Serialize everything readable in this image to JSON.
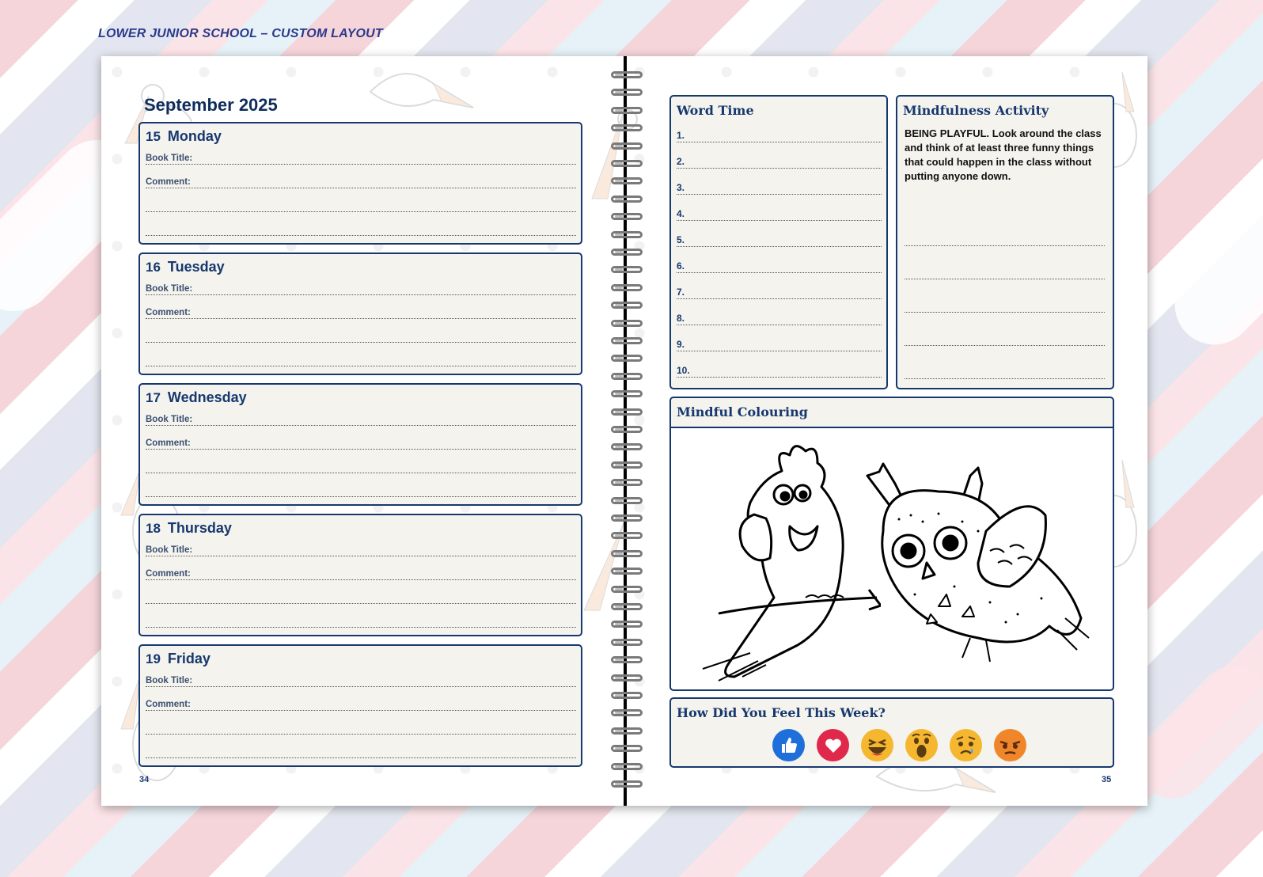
{
  "header_label": "LOWER JUNIOR SCHOOL – CUSTOM LAYOUT",
  "left_page": {
    "month_title": "September 2025",
    "page_number": "34",
    "days": [
      {
        "num": "15",
        "name": "Monday",
        "book_label": "Book Title:",
        "comment_label": "Comment:"
      },
      {
        "num": "16",
        "name": "Tuesday",
        "book_label": "Book Title:",
        "comment_label": "Comment:"
      },
      {
        "num": "17",
        "name": "Wednesday",
        "book_label": "Book Title:",
        "comment_label": "Comment:"
      },
      {
        "num": "18",
        "name": "Thursday",
        "book_label": "Book Title:",
        "comment_label": "Comment:"
      },
      {
        "num": "19",
        "name": "Friday",
        "book_label": "Book Title:",
        "comment_label": "Comment:"
      }
    ]
  },
  "right_page": {
    "page_number": "35",
    "word_time": {
      "title": "Word Time",
      "numbers": [
        "1.",
        "2.",
        "3.",
        "4.",
        "5.",
        "6.",
        "7.",
        "8.",
        "9.",
        "10."
      ]
    },
    "mindfulness": {
      "title": "Mindfulness Activity",
      "text": "BEING PLAYFUL. Look around the class and think of at least three funny things that could happen in the class without putting anyone down."
    },
    "colouring": {
      "title": "Mindful Colouring",
      "images": [
        "cockatoo-outline",
        "owl-outline"
      ]
    },
    "feelings": {
      "title": "How Did You Feel This Week?",
      "emojis": [
        {
          "name": "like-icon",
          "color": "#1e6fd9"
        },
        {
          "name": "love-icon",
          "color": "#e0284a"
        },
        {
          "name": "haha-icon",
          "color": "#f5b72f"
        },
        {
          "name": "wow-icon",
          "color": "#f5b72f"
        },
        {
          "name": "sad-icon",
          "color": "#f5b72f"
        },
        {
          "name": "angry-icon",
          "color": "#f0862a"
        }
      ]
    }
  }
}
